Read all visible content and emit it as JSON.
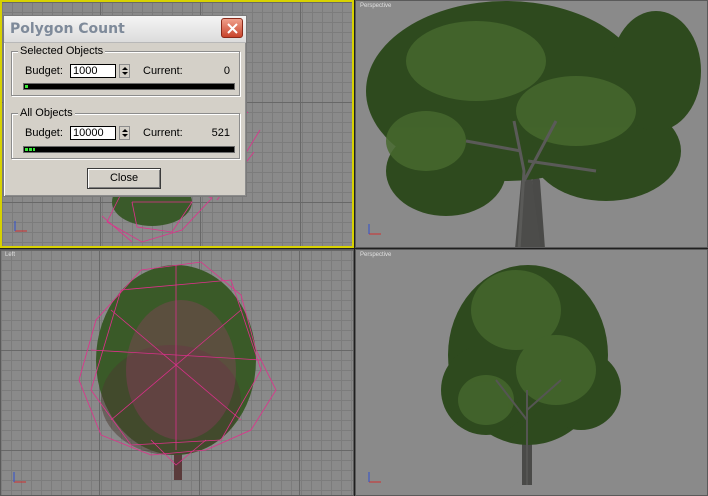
{
  "dialog": {
    "title": "Polygon Count",
    "selected_objects": {
      "legend": "Selected Objects",
      "budget_label": "Budget:",
      "budget_value": "1000",
      "current_label": "Current:",
      "current_value": "0",
      "progress": 0.02
    },
    "all_objects": {
      "legend": "All Objects",
      "budget_label": "Budget:",
      "budget_value": "10000",
      "current_label": "Current:",
      "current_value": "521",
      "progress": 0.05
    },
    "close_label": "Close"
  },
  "viewports": {
    "top_right": {
      "label": "Perspective"
    },
    "bottom_left": {
      "label": "Left"
    },
    "bottom_right": {
      "label": "Perspective"
    }
  },
  "colors": {
    "active_viewport_border": "#d8d200",
    "wireframe": "#e0308c",
    "foliage": "#3c5a2a",
    "progress_fill": "#38e838"
  }
}
